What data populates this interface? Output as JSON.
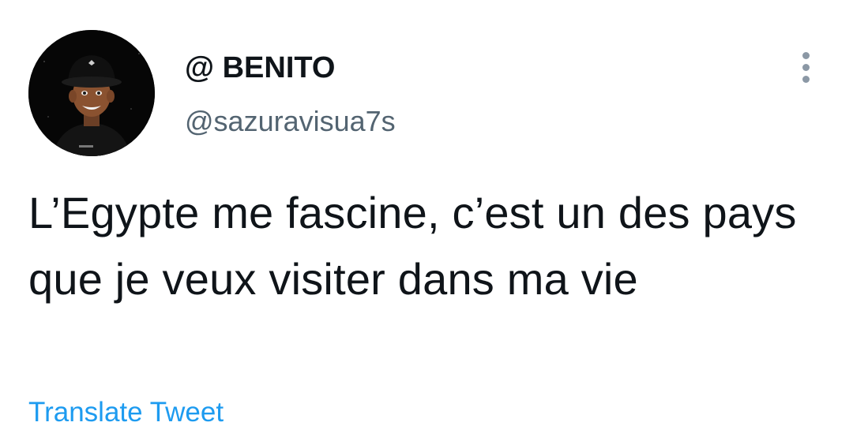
{
  "author": {
    "display_name": "@ BENITO",
    "handle": "@sazuravisua7s",
    "avatar_icon": "profile-avatar"
  },
  "tweet": {
    "text": "L’Egypte me fascine, c’est un des pays que je veux visiter dans ma vie"
  },
  "actions": {
    "more_icon": "more-vertical-icon",
    "translate_label": "Translate Tweet"
  },
  "colors": {
    "text_primary": "#0f1419",
    "text_secondary": "#536471",
    "link": "#1d9bf0",
    "background": "#ffffff"
  }
}
